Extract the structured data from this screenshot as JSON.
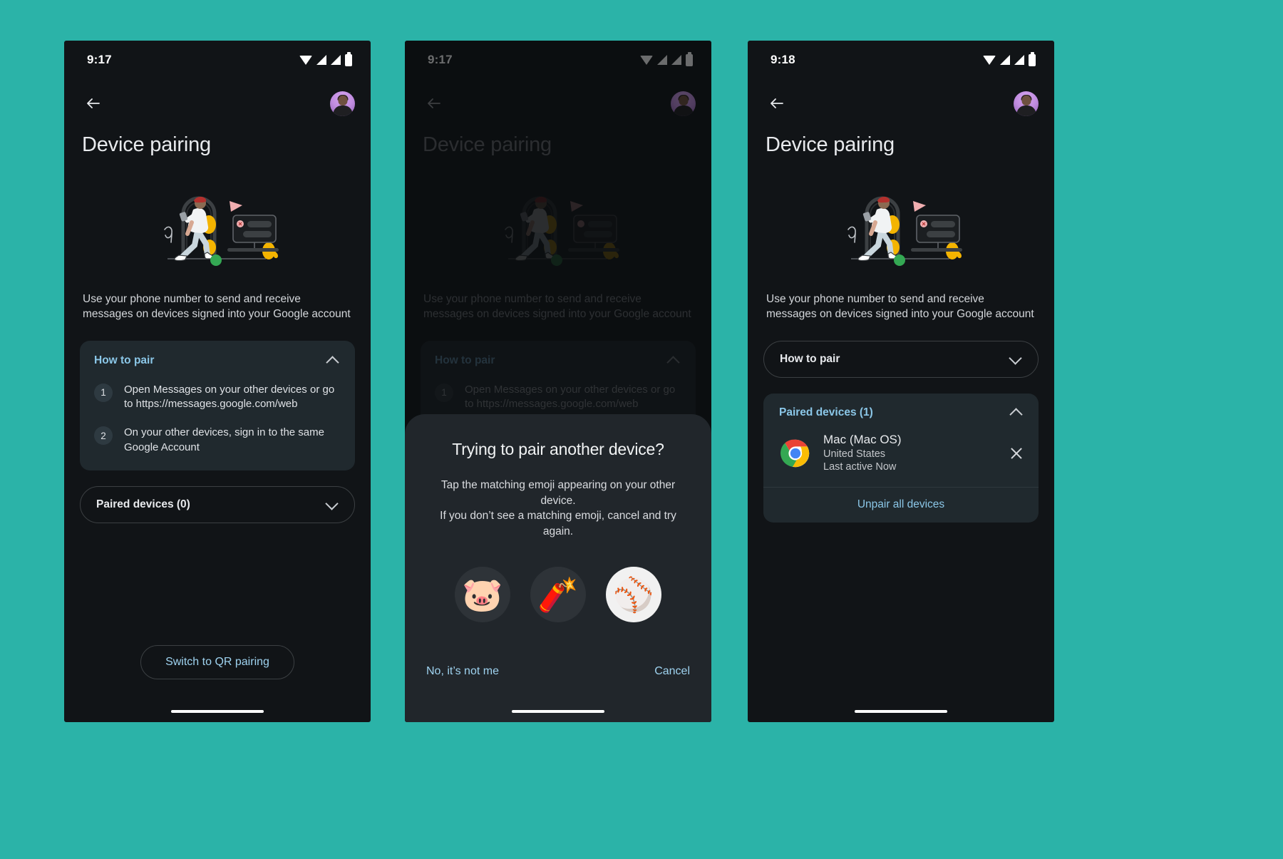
{
  "canvas": {
    "background": "#2bb3a8"
  },
  "shared": {
    "app_title": "Device pairing",
    "subtitle_line1": "Use your phone number to send and receive messages",
    "subtitle_line2": "on devices signed into your Google account",
    "back_icon": "back-arrow-icon",
    "avatar_label": "account-avatar",
    "how_to_pair_label": "How to pair",
    "steps": [
      {
        "num": "1",
        "text": "Open Messages on your other devices or go to https://messages.google.com/web"
      },
      {
        "num": "2",
        "text": "On your other devices, sign in to the same Google Account"
      }
    ],
    "accent_blue": "#8bc7e8",
    "card_bg": "#20292e",
    "screen_bg": "#111417"
  },
  "phone1": {
    "status": {
      "time": "9:17",
      "wifi": "wifi-icon",
      "signal": "signal-icon",
      "battery": "battery-icon"
    },
    "paired_devices_label": "Paired devices (0)",
    "qr_button_label": "Switch to QR pairing"
  },
  "phone2": {
    "status": {
      "time": "9:17",
      "wifi": "wifi-icon",
      "signal": "signal-icon",
      "battery": "battery-icon"
    },
    "dialog": {
      "title": "Trying to pair another device?",
      "body_line1": "Tap the matching emoji appearing on your other device.",
      "body_line2": "If you don’t see a matching emoji, cancel and try again.",
      "emojis": [
        {
          "glyph": "🐷",
          "name": "pig-face-emoji",
          "style": "dark"
        },
        {
          "glyph": "🧨",
          "name": "firecracker-emoji",
          "style": "dark"
        },
        {
          "glyph": "⚾",
          "name": "baseball-emoji",
          "style": "light"
        }
      ],
      "deny_label": "No, it’s not me",
      "cancel_label": "Cancel"
    }
  },
  "phone3": {
    "status": {
      "time": "9:18",
      "wifi": "wifi-icon",
      "signal": "signal-icon",
      "battery": "battery-icon"
    },
    "how_to_pair_label": "How to pair",
    "paired_devices_label": "Paired devices (1)",
    "device": {
      "icon": "chrome-icon",
      "name": "Mac (Mac OS)",
      "location": "United States",
      "last_active": "Last active Now"
    },
    "unpair_all_label": "Unpair all devices"
  }
}
